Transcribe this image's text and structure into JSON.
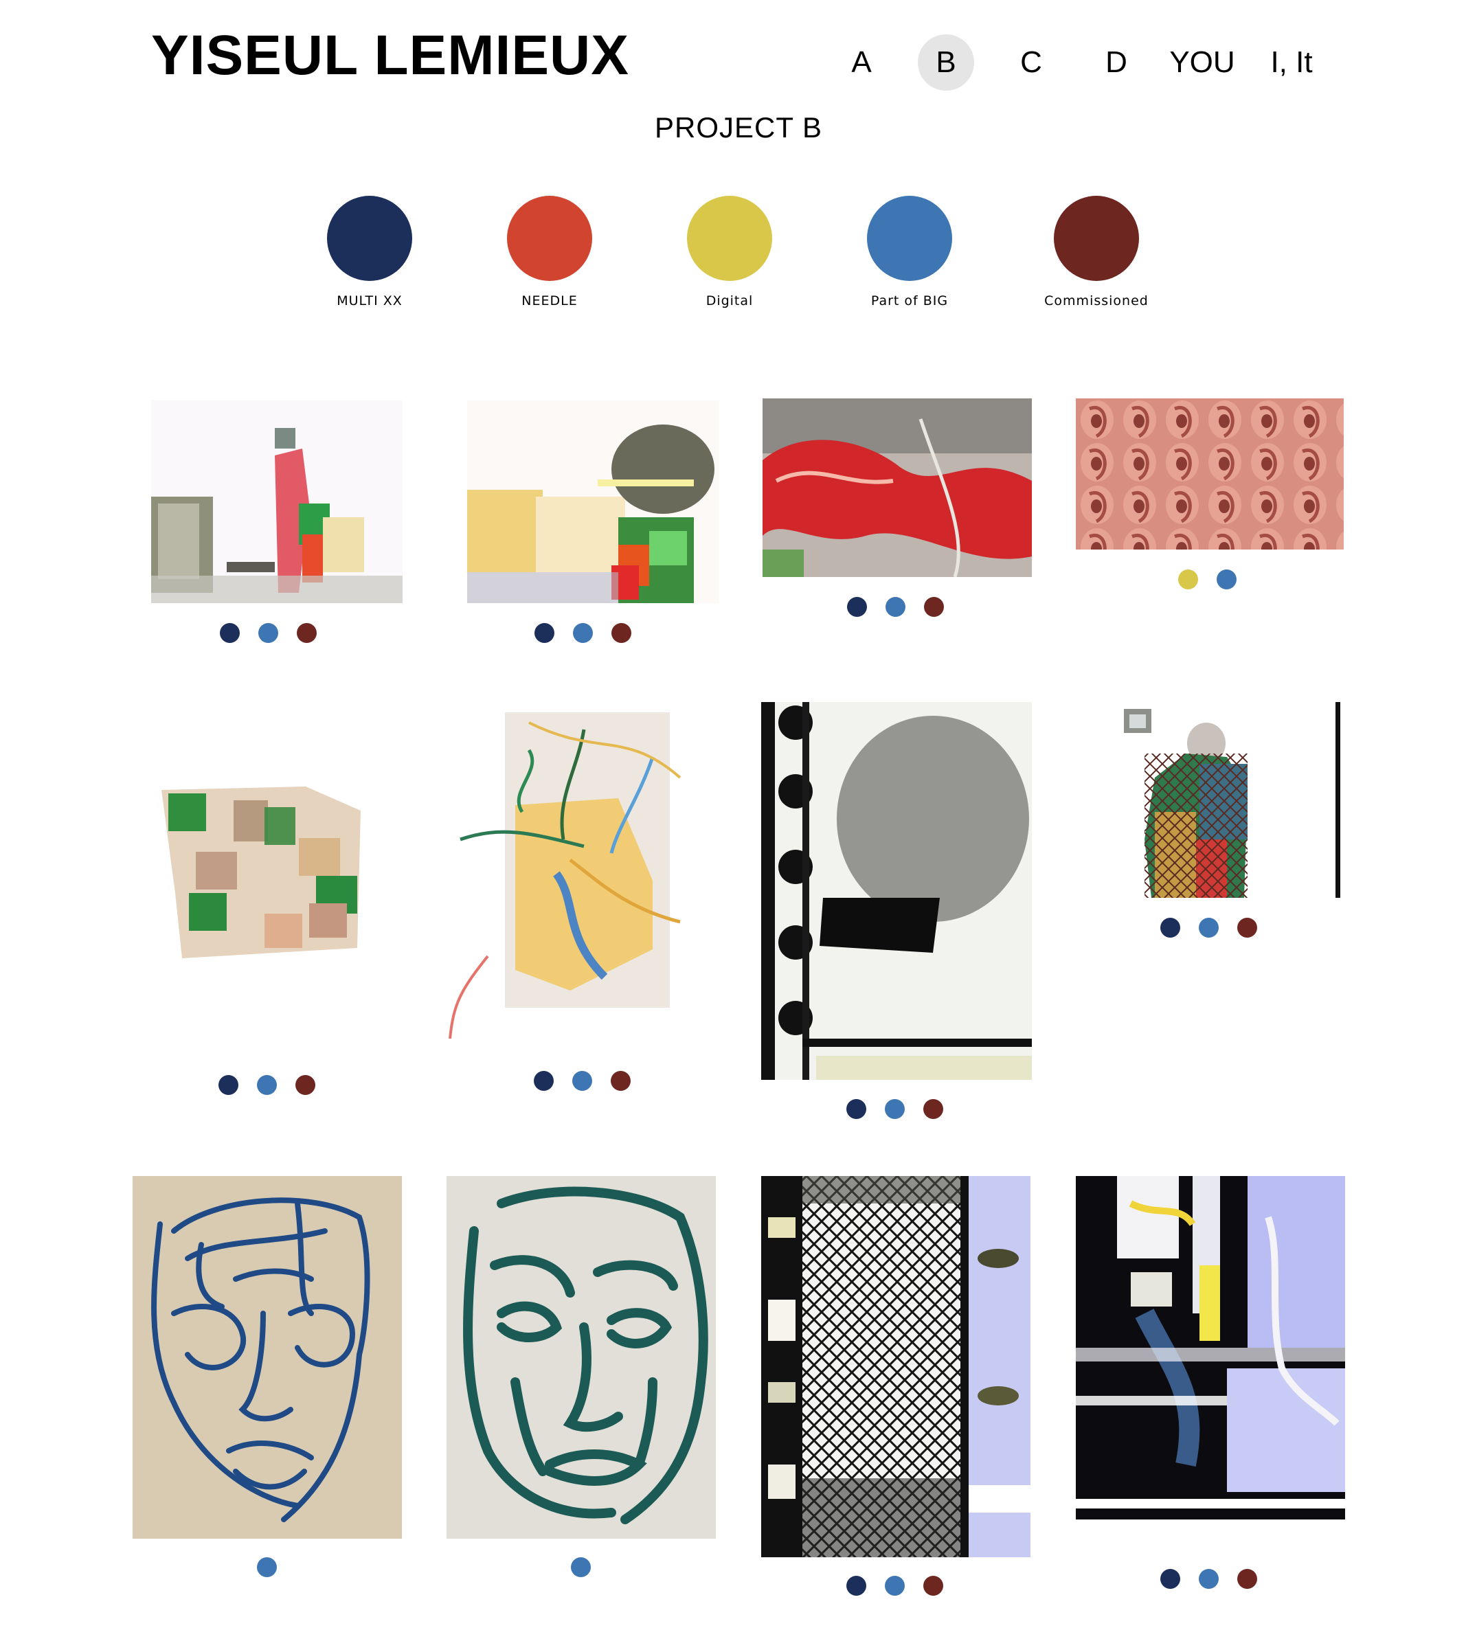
{
  "site": {
    "title": "YISEUL LEMIEUX"
  },
  "nav": {
    "items": [
      "A",
      "B",
      "C",
      "D",
      "YOU",
      "I, It"
    ],
    "active": "B"
  },
  "page": {
    "title": "PROJECT B"
  },
  "colors": {
    "navy": "#1b2f5a",
    "red": "#d04430",
    "yellow": "#d9c74a",
    "blue": "#3d76b3",
    "maroon": "#6e2620"
  },
  "legend": [
    {
      "label": "MULTI XX",
      "color": "#1b2f5a"
    },
    {
      "label": "NEEDLE",
      "color": "#d04430"
    },
    {
      "label": "Digital",
      "color": "#d9c74a"
    },
    {
      "label": "Part of BIG",
      "color": "#3d76b3"
    },
    {
      "label": "Commissioned",
      "color": "#6e2620"
    }
  ],
  "gallery": [
    {
      "tags": [
        "#1b2f5a",
        "#3d76b3",
        "#6e2620"
      ]
    },
    {
      "tags": [
        "#1b2f5a",
        "#3d76b3",
        "#6e2620"
      ]
    },
    {
      "tags": [
        "#1b2f5a",
        "#3d76b3",
        "#6e2620"
      ]
    },
    {
      "tags": [
        "#d9c74a",
        "#3d76b3"
      ]
    },
    {
      "tags": [
        "#1b2f5a",
        "#3d76b3",
        "#6e2620"
      ]
    },
    {
      "tags": [
        "#1b2f5a",
        "#3d76b3",
        "#6e2620"
      ]
    },
    {
      "tags": [
        "#1b2f5a",
        "#3d76b3",
        "#6e2620"
      ]
    },
    {
      "tags": [
        "#1b2f5a",
        "#3d76b3",
        "#6e2620"
      ]
    },
    {
      "tags": [
        "#3d76b3"
      ]
    },
    {
      "tags": [
        "#3d76b3"
      ]
    },
    {
      "tags": [
        "#1b2f5a",
        "#3d76b3",
        "#6e2620"
      ]
    },
    {
      "tags": [
        "#1b2f5a",
        "#3d76b3",
        "#6e2620"
      ]
    }
  ]
}
